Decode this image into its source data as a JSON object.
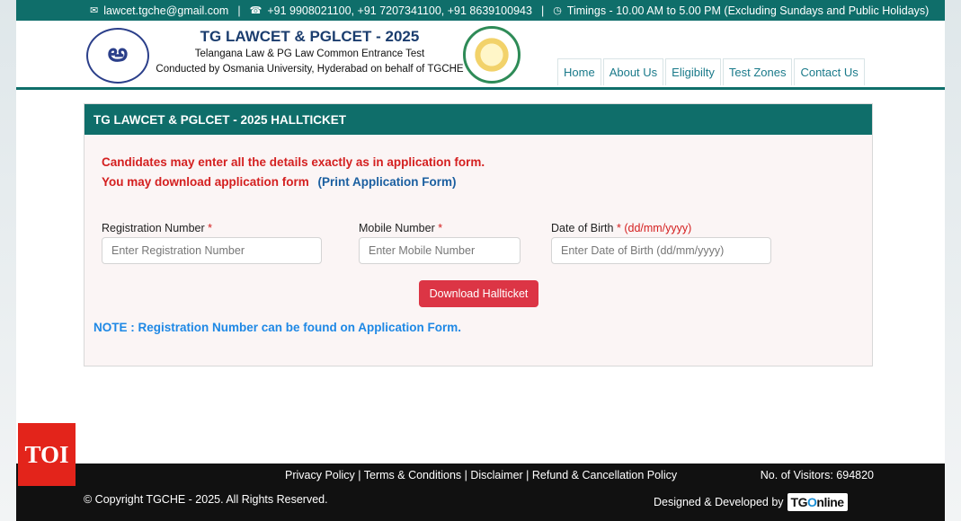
{
  "topbar": {
    "email": "lawcet.tgche@gmail.com",
    "phones": "+91 9908021100, +91 7207341100, +91 8639100943",
    "timings": "Timings - 10.00 AM to 5.00 PM (Excluding Sundays and Public Holidays)"
  },
  "header": {
    "title": "TG LAWCET & PGLCET - 2025",
    "subtitle": "Telangana Law & PG Law Common Entrance Test",
    "conducted_by": "Conducted by Osmania University, Hyderabad on behalf of TGCHE",
    "tgche_logo_text": "TELANGANA COUNCIL OF HIGHER EDUCATION"
  },
  "nav": [
    "Home",
    "About Us",
    "Eligibilty",
    "Test Zones",
    "Contact Us"
  ],
  "card": {
    "heading": "TG LAWCET & PGLCET - 2025 HALLTICKET",
    "msg1": "Candidates may enter all the details exactly as in application form.",
    "msg2": "You may download application form",
    "msg2_link": "(Print Application Form)",
    "fields": {
      "reg_label": "Registration Number",
      "reg_placeholder": "Enter Registration Number",
      "mobile_label": "Mobile Number",
      "mobile_placeholder": "Enter Mobile Number",
      "dob_label": "Date of Birth",
      "dob_format": "(dd/mm/yyyy)",
      "dob_placeholder": "Enter Date of Birth (dd/mm/yyyy)",
      "required_mark": "*"
    },
    "button": "Download Hallticket",
    "note": "NOTE : Registration Number can be found on Application Form."
  },
  "footer": {
    "links": [
      "Privacy Policy",
      "Terms & Conditions",
      "Disclaimer",
      "Refund & Cancellation Policy"
    ],
    "visitors": "No. of Visitors: 694820",
    "copyright": "© Copyright TGCHE - 2025. All Rights Reserved.",
    "designed": "Designed & Developed by",
    "brand_tg": "TG",
    "brand_o": "O",
    "brand_rest": "nline"
  },
  "watermark": "TOI",
  "colors": {
    "teal": "#0f6e6a",
    "red": "#d42020",
    "button": "#dc3545",
    "note": "#1e88e5"
  }
}
